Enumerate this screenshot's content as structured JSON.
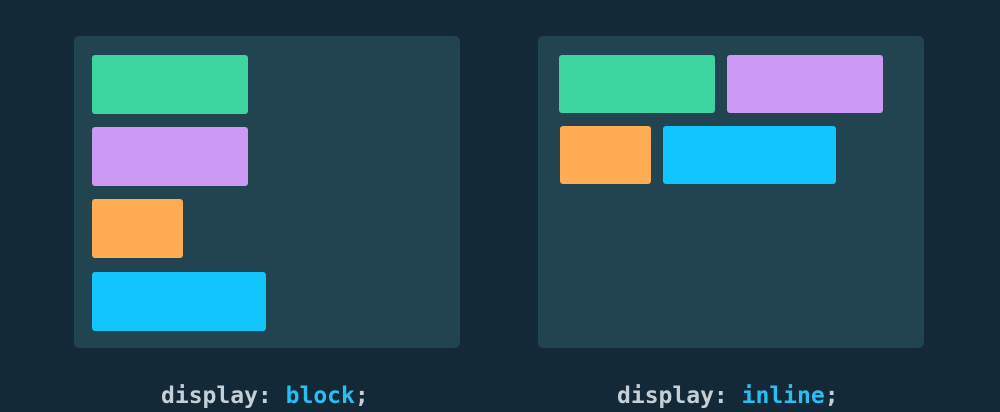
{
  "colors": {
    "background": "#142937",
    "panel": "#224350",
    "green": "#3DD6A0",
    "purple": "#CC99F5",
    "orange": "#FFAC52",
    "blue": "#11C5FF",
    "caption_key": "#C5D0D6",
    "caption_value": "#28C0F2"
  },
  "panels": {
    "block": {
      "boxes": [
        "green",
        "purple",
        "orange",
        "blue"
      ],
      "caption": {
        "property": "display: ",
        "value": "block",
        "terminator": ";"
      }
    },
    "inline": {
      "boxes": [
        "green",
        "purple",
        "orange",
        "blue"
      ],
      "caption": {
        "property": "display: ",
        "value": "inline",
        "terminator": ";"
      }
    }
  }
}
